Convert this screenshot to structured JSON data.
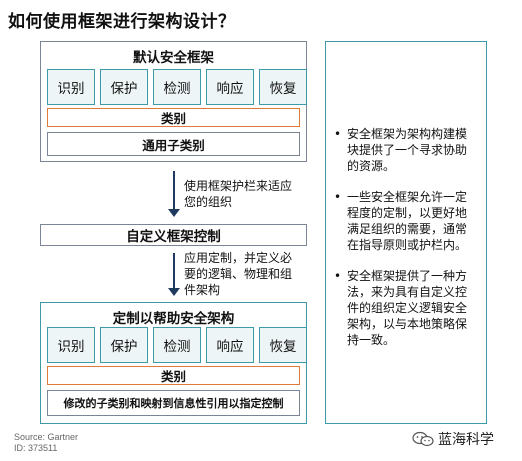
{
  "title": "如何使用框架进行架构设计？",
  "top_panel": {
    "heading": "默认安全框架",
    "capabilities": [
      "识别",
      "保护",
      "检测",
      "响应",
      "恢复"
    ],
    "category": "类别",
    "subcategory": "通用子类别"
  },
  "step1_text": [
    "使用框架护栏来适应",
    "您的组织"
  ],
  "custom_controls": "自定义框架控制",
  "step2_text": [
    "应用定制，并定义必",
    "要的逻辑、物理和组",
    "件架构"
  ],
  "bottom_panel": {
    "heading": "定制以帮助安全架构",
    "capabilities": [
      "识别",
      "保护",
      "检测",
      "响应",
      "恢复"
    ],
    "category": "类别",
    "subcategory": "修改的子类别和映射到信息性引用以指定控制"
  },
  "notes": [
    [
      "安全框架为架构构建模",
      "块提供了一个寻求协助",
      "的资源。"
    ],
    [
      "一些安全框架允许一定",
      "程度的定制，以更好地",
      "满足组织的需要，通常",
      "在指导原则或护栏内。"
    ],
    [
      "安全框架提供了一种方",
      "法，来为具有自定义控",
      "件的组织定义逻辑安全",
      "架构，以与本地策略保",
      "持一致。"
    ]
  ],
  "source_line1": "Source: Gartner",
  "source_line2": "ID: 373511",
  "watermark": "蓝海科学",
  "colors": {
    "teal": "#3d9aa8",
    "orange": "#e07a3a",
    "gray_border": "#7b8595",
    "arrow": "#1f3a5f",
    "cap_fill": "#eef5f6"
  }
}
